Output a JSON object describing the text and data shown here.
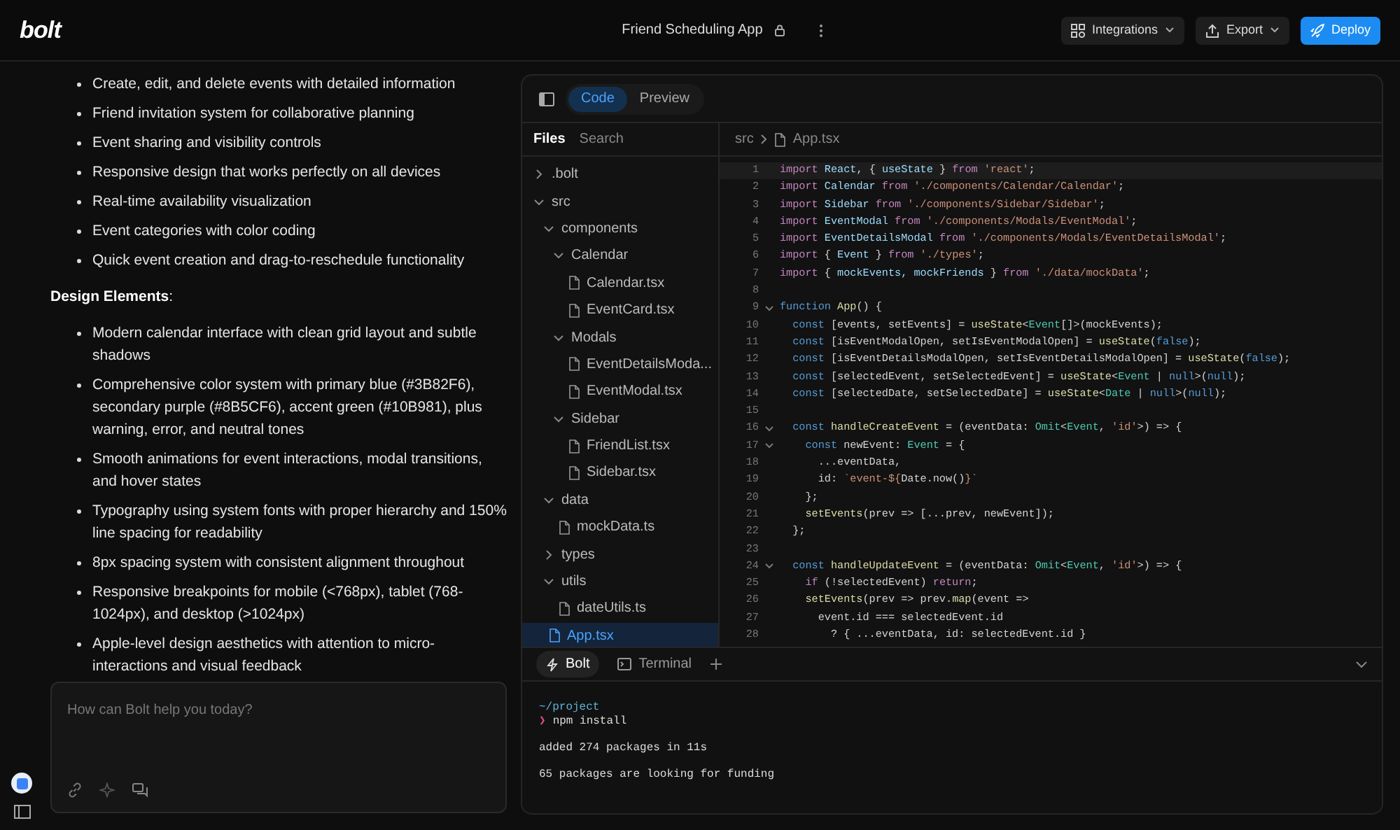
{
  "header": {
    "logo": "bolt",
    "project_title": "Friend Scheduling App",
    "buttons": [
      {
        "kind": "integrations",
        "label": "Integrations"
      },
      {
        "kind": "export",
        "label": "Export"
      },
      {
        "kind": "deploy",
        "label": "Deploy"
      }
    ]
  },
  "chat": {
    "features": [
      "Create, edit, and delete events with detailed information",
      "Friend invitation system for collaborative planning",
      "Event sharing and visibility controls",
      "Responsive design that works perfectly on all devices",
      "Real-time availability visualization",
      "Event categories with color coding",
      "Quick event creation and drag-to-reschedule functionality"
    ],
    "design_heading": "**Design Elements**:",
    "design_elements": [
      "Modern calendar interface with clean grid layout and subtle shadows",
      "Comprehensive color system with primary blue (#3B82F6), secondary purple (#8B5CF6), accent green (#10B981), plus warning, error, and neutral tones",
      "Smooth animations for event interactions, modal transitions, and hover states",
      "Typography using system fonts with proper hierarchy and 150% line spacing for readability",
      "8px spacing system with consistent alignment throughout",
      "Responsive breakpoints for mobile (<768px), tablet (768-1024px), and desktop (>1024px)",
      "Apple-level design aesthetics with attention to micro-interactions and visual feedback"
    ],
    "input": {
      "placeholder": "How can Bolt help you today?"
    }
  },
  "workbench": {
    "view_tabs": [
      {
        "label": "Code",
        "selected": true
      },
      {
        "label": "Preview",
        "selected": false
      }
    ],
    "sidebar_tabs": [
      {
        "label": "Files",
        "selected": true
      },
      {
        "label": "Search",
        "selected": false
      }
    ],
    "file_tree": [
      {
        "kind": "folder",
        "name": ".bolt",
        "expanded": false
      },
      {
        "kind": "folder",
        "name": "src",
        "expanded": true,
        "children": [
          {
            "kind": "folder",
            "name": "components",
            "expanded": true,
            "children": [
              {
                "kind": "folder",
                "name": "Calendar",
                "expanded": true,
                "children": [
                  {
                    "kind": "file",
                    "name": "Calendar.tsx",
                    "selected": false
                  },
                  {
                    "kind": "file",
                    "name": "EventCard.tsx",
                    "selected": false
                  }
                ]
              },
              {
                "kind": "folder",
                "name": "Modals",
                "expanded": true,
                "children": [
                  {
                    "kind": "file",
                    "name": "EventDetailsModa...",
                    "selected": false
                  },
                  {
                    "kind": "file",
                    "name": "EventModal.tsx",
                    "selected": false
                  }
                ]
              },
              {
                "kind": "folder",
                "name": "Sidebar",
                "expanded": true,
                "children": [
                  {
                    "kind": "file",
                    "name": "FriendList.tsx",
                    "selected": false
                  },
                  {
                    "kind": "file",
                    "name": "Sidebar.tsx",
                    "selected": false
                  }
                ]
              }
            ]
          },
          {
            "kind": "folder",
            "name": "data",
            "expanded": true,
            "children": [
              {
                "kind": "file",
                "name": "mockData.ts",
                "selected": false
              }
            ]
          },
          {
            "kind": "folder",
            "name": "types",
            "expanded": false
          },
          {
            "kind": "folder",
            "name": "utils",
            "expanded": true,
            "children": [
              {
                "kind": "file",
                "name": "dateUtils.ts",
                "selected": false
              }
            ]
          },
          {
            "kind": "file",
            "name": "App.tsx",
            "selected": true
          }
        ]
      }
    ],
    "breadcrumb": [
      "src",
      "App.tsx"
    ],
    "code_lines": [
      {
        "number": "1",
        "current": true,
        "foldable": false,
        "tokens": [
          {
            "kind": "kw",
            "text": "import "
          },
          {
            "kind": "var",
            "text": "React"
          },
          {
            "kind": "plain",
            "text": ", { "
          },
          {
            "kind": "var",
            "text": "useState"
          },
          {
            "kind": "plain",
            "text": " } "
          },
          {
            "kind": "kw",
            "text": "from "
          },
          {
            "kind": "str",
            "text": "'react'"
          },
          {
            "kind": "plain",
            "text": ";"
          }
        ]
      },
      {
        "number": "2",
        "current": false,
        "foldable": false,
        "tokens": [
          {
            "kind": "kw",
            "text": "import "
          },
          {
            "kind": "var",
            "text": "Calendar"
          },
          {
            "kind": "kw",
            "text": " from "
          },
          {
            "kind": "str",
            "text": "'./components/Calendar/Calendar'"
          },
          {
            "kind": "plain",
            "text": ";"
          }
        ]
      },
      {
        "number": "3",
        "current": false,
        "foldable": false,
        "tokens": [
          {
            "kind": "kw",
            "text": "import "
          },
          {
            "kind": "var",
            "text": "Sidebar"
          },
          {
            "kind": "kw",
            "text": " from "
          },
          {
            "kind": "str",
            "text": "'./components/Sidebar/Sidebar'"
          },
          {
            "kind": "plain",
            "text": ";"
          }
        ]
      },
      {
        "number": "4",
        "current": false,
        "foldable": false,
        "tokens": [
          {
            "kind": "kw",
            "text": "import "
          },
          {
            "kind": "var",
            "text": "EventModal"
          },
          {
            "kind": "kw",
            "text": " from "
          },
          {
            "kind": "str",
            "text": "'./components/Modals/EventModal'"
          },
          {
            "kind": "plain",
            "text": ";"
          }
        ]
      },
      {
        "number": "5",
        "current": false,
        "foldable": false,
        "tokens": [
          {
            "kind": "kw",
            "text": "import "
          },
          {
            "kind": "var",
            "text": "EventDetailsModal"
          },
          {
            "kind": "kw",
            "text": " from "
          },
          {
            "kind": "str",
            "text": "'./components/Modals/EventDetailsModal'"
          },
          {
            "kind": "plain",
            "text": ";"
          }
        ]
      },
      {
        "number": "6",
        "current": false,
        "foldable": false,
        "tokens": [
          {
            "kind": "kw",
            "text": "import "
          },
          {
            "kind": "plain",
            "text": "{ "
          },
          {
            "kind": "var",
            "text": "Event"
          },
          {
            "kind": "plain",
            "text": " } "
          },
          {
            "kind": "kw",
            "text": "from "
          },
          {
            "kind": "str",
            "text": "'./types'"
          },
          {
            "kind": "plain",
            "text": ";"
          }
        ]
      },
      {
        "number": "7",
        "current": false,
        "foldable": false,
        "tokens": [
          {
            "kind": "kw",
            "text": "import "
          },
          {
            "kind": "plain",
            "text": "{ "
          },
          {
            "kind": "var",
            "text": "mockEvents, mockFriends"
          },
          {
            "kind": "plain",
            "text": " } "
          },
          {
            "kind": "kw",
            "text": "from "
          },
          {
            "kind": "str",
            "text": "'./data/mockData'"
          },
          {
            "kind": "plain",
            "text": ";"
          }
        ]
      },
      {
        "number": "8",
        "current": false,
        "foldable": false
      },
      {
        "number": "9",
        "current": false,
        "foldable": true,
        "tokens": [
          {
            "kind": "const",
            "text": "function "
          },
          {
            "kind": "fn",
            "text": "App"
          },
          {
            "kind": "plain",
            "text": "() {"
          }
        ]
      },
      {
        "number": "10",
        "current": false,
        "foldable": false,
        "tokens": [
          {
            "kind": "const",
            "text": "  const "
          },
          {
            "kind": "plain",
            "text": "[events, setEvents] = "
          },
          {
            "kind": "fn",
            "text": "useState"
          },
          {
            "kind": "plain",
            "text": "<"
          },
          {
            "kind": "type",
            "text": "Event"
          },
          {
            "kind": "plain",
            "text": "[]>(mockEvents);"
          }
        ]
      },
      {
        "number": "11",
        "current": false,
        "foldable": false,
        "tokens": [
          {
            "kind": "const",
            "text": "  const "
          },
          {
            "kind": "plain",
            "text": "[isEventModalOpen, setIsEventModalOpen] = "
          },
          {
            "kind": "fn",
            "text": "useState"
          },
          {
            "kind": "plain",
            "text": "("
          },
          {
            "kind": "lit",
            "text": "false"
          },
          {
            "kind": "plain",
            "text": ");"
          }
        ]
      },
      {
        "number": "12",
        "current": false,
        "foldable": false,
        "tokens": [
          {
            "kind": "const",
            "text": "  const "
          },
          {
            "kind": "plain",
            "text": "[isEventDetailsModalOpen, setIsEventDetailsModalOpen] = "
          },
          {
            "kind": "fn",
            "text": "useState"
          },
          {
            "kind": "plain",
            "text": "("
          },
          {
            "kind": "lit",
            "text": "false"
          },
          {
            "kind": "plain",
            "text": ");"
          }
        ]
      },
      {
        "number": "13",
        "current": false,
        "foldable": false,
        "tokens": [
          {
            "kind": "const",
            "text": "  const "
          },
          {
            "kind": "plain",
            "text": "[selectedEvent, setSelectedEvent] = "
          },
          {
            "kind": "fn",
            "text": "useState"
          },
          {
            "kind": "plain",
            "text": "<"
          },
          {
            "kind": "type",
            "text": "Event"
          },
          {
            "kind": "plain",
            "text": " | "
          },
          {
            "kind": "lit",
            "text": "null"
          },
          {
            "kind": "plain",
            "text": ">("
          },
          {
            "kind": "lit",
            "text": "null"
          },
          {
            "kind": "plain",
            "text": ");"
          }
        ]
      },
      {
        "number": "14",
        "current": false,
        "foldable": false,
        "tokens": [
          {
            "kind": "const",
            "text": "  const "
          },
          {
            "kind": "plain",
            "text": "[selectedDate, setSelectedDate] = "
          },
          {
            "kind": "fn",
            "text": "useState"
          },
          {
            "kind": "plain",
            "text": "<"
          },
          {
            "kind": "type",
            "text": "Date"
          },
          {
            "kind": "plain",
            "text": " | "
          },
          {
            "kind": "lit",
            "text": "null"
          },
          {
            "kind": "plain",
            "text": ">("
          },
          {
            "kind": "lit",
            "text": "null"
          },
          {
            "kind": "plain",
            "text": ");"
          }
        ]
      },
      {
        "number": "15",
        "current": false,
        "foldable": false
      },
      {
        "number": "16",
        "current": false,
        "foldable": true,
        "tokens": [
          {
            "kind": "const",
            "text": "  const "
          },
          {
            "kind": "fn",
            "text": "handleCreateEvent"
          },
          {
            "kind": "plain",
            "text": " = (eventData: "
          },
          {
            "kind": "type",
            "text": "Omit"
          },
          {
            "kind": "plain",
            "text": "<"
          },
          {
            "kind": "type",
            "text": "Event"
          },
          {
            "kind": "plain",
            "text": ", "
          },
          {
            "kind": "str",
            "text": "'id'"
          },
          {
            "kind": "plain",
            "text": ">) => {"
          }
        ]
      },
      {
        "number": "17",
        "current": false,
        "foldable": true,
        "tokens": [
          {
            "kind": "const",
            "text": "    const "
          },
          {
            "kind": "plain",
            "text": "newEvent: "
          },
          {
            "kind": "type",
            "text": "Event"
          },
          {
            "kind": "plain",
            "text": " = {"
          }
        ]
      },
      {
        "number": "18",
        "current": false,
        "foldable": false,
        "tokens": [
          {
            "kind": "plain",
            "text": "      ...eventData,"
          }
        ]
      },
      {
        "number": "19",
        "current": false,
        "foldable": false,
        "tokens": [
          {
            "kind": "plain",
            "text": "      id: "
          },
          {
            "kind": "str",
            "text": "`event-${"
          },
          {
            "kind": "plain",
            "text": "Date.now()"
          },
          {
            "kind": "str",
            "text": "}`"
          }
        ]
      },
      {
        "number": "20",
        "current": false,
        "foldable": false,
        "tokens": [
          {
            "kind": "plain",
            "text": "    };"
          }
        ]
      },
      {
        "number": "21",
        "current": false,
        "foldable": false,
        "tokens": [
          {
            "kind": "fn",
            "text": "    setEvents"
          },
          {
            "kind": "plain",
            "text": "(prev => [...prev, newEvent]);"
          }
        ]
      },
      {
        "number": "22",
        "current": false,
        "foldable": false,
        "tokens": [
          {
            "kind": "plain",
            "text": "  };"
          }
        ]
      },
      {
        "number": "23",
        "current": false,
        "foldable": false
      },
      {
        "number": "24",
        "current": false,
        "foldable": true,
        "tokens": [
          {
            "kind": "const",
            "text": "  const "
          },
          {
            "kind": "fn",
            "text": "handleUpdateEvent"
          },
          {
            "kind": "plain",
            "text": " = (eventData: "
          },
          {
            "kind": "type",
            "text": "Omit"
          },
          {
            "kind": "plain",
            "text": "<"
          },
          {
            "kind": "type",
            "text": "Event"
          },
          {
            "kind": "plain",
            "text": ", "
          },
          {
            "kind": "str",
            "text": "'id'"
          },
          {
            "kind": "plain",
            "text": ">) => {"
          }
        ]
      },
      {
        "number": "25",
        "current": false,
        "foldable": false,
        "tokens": [
          {
            "kind": "kw",
            "text": "    if "
          },
          {
            "kind": "plain",
            "text": "(!selectedEvent) "
          },
          {
            "kind": "kw",
            "text": "return"
          },
          {
            "kind": "plain",
            "text": ";"
          }
        ]
      },
      {
        "number": "26",
        "current": false,
        "foldable": false,
        "tokens": [
          {
            "kind": "fn",
            "text": "    setEvents"
          },
          {
            "kind": "plain",
            "text": "(prev => prev."
          },
          {
            "kind": "fn",
            "text": "map"
          },
          {
            "kind": "plain",
            "text": "(event =>"
          }
        ]
      },
      {
        "number": "27",
        "current": false,
        "foldable": false,
        "tokens": [
          {
            "kind": "plain",
            "text": "      event.id === selectedEvent.id"
          }
        ]
      },
      {
        "number": "28",
        "current": false,
        "foldable": false,
        "tokens": [
          {
            "kind": "plain",
            "text": "        ? { ...eventData, id: selectedEvent.id }"
          }
        ]
      }
    ],
    "terminal_tabs": [
      {
        "kind": "bolt",
        "label": "Bolt",
        "selected": true
      },
      {
        "kind": "terminal",
        "label": "Terminal",
        "selected": false
      }
    ],
    "terminal_lines": [
      {
        "kind": "path",
        "text": "~/project"
      },
      {
        "kind": "command",
        "prompt": "❯",
        "text": "npm install"
      },
      {
        "kind": "output",
        "text": "added 274 packages in 11s"
      },
      {
        "kind": "output",
        "text": "65 packages are looking for funding"
      }
    ]
  }
}
